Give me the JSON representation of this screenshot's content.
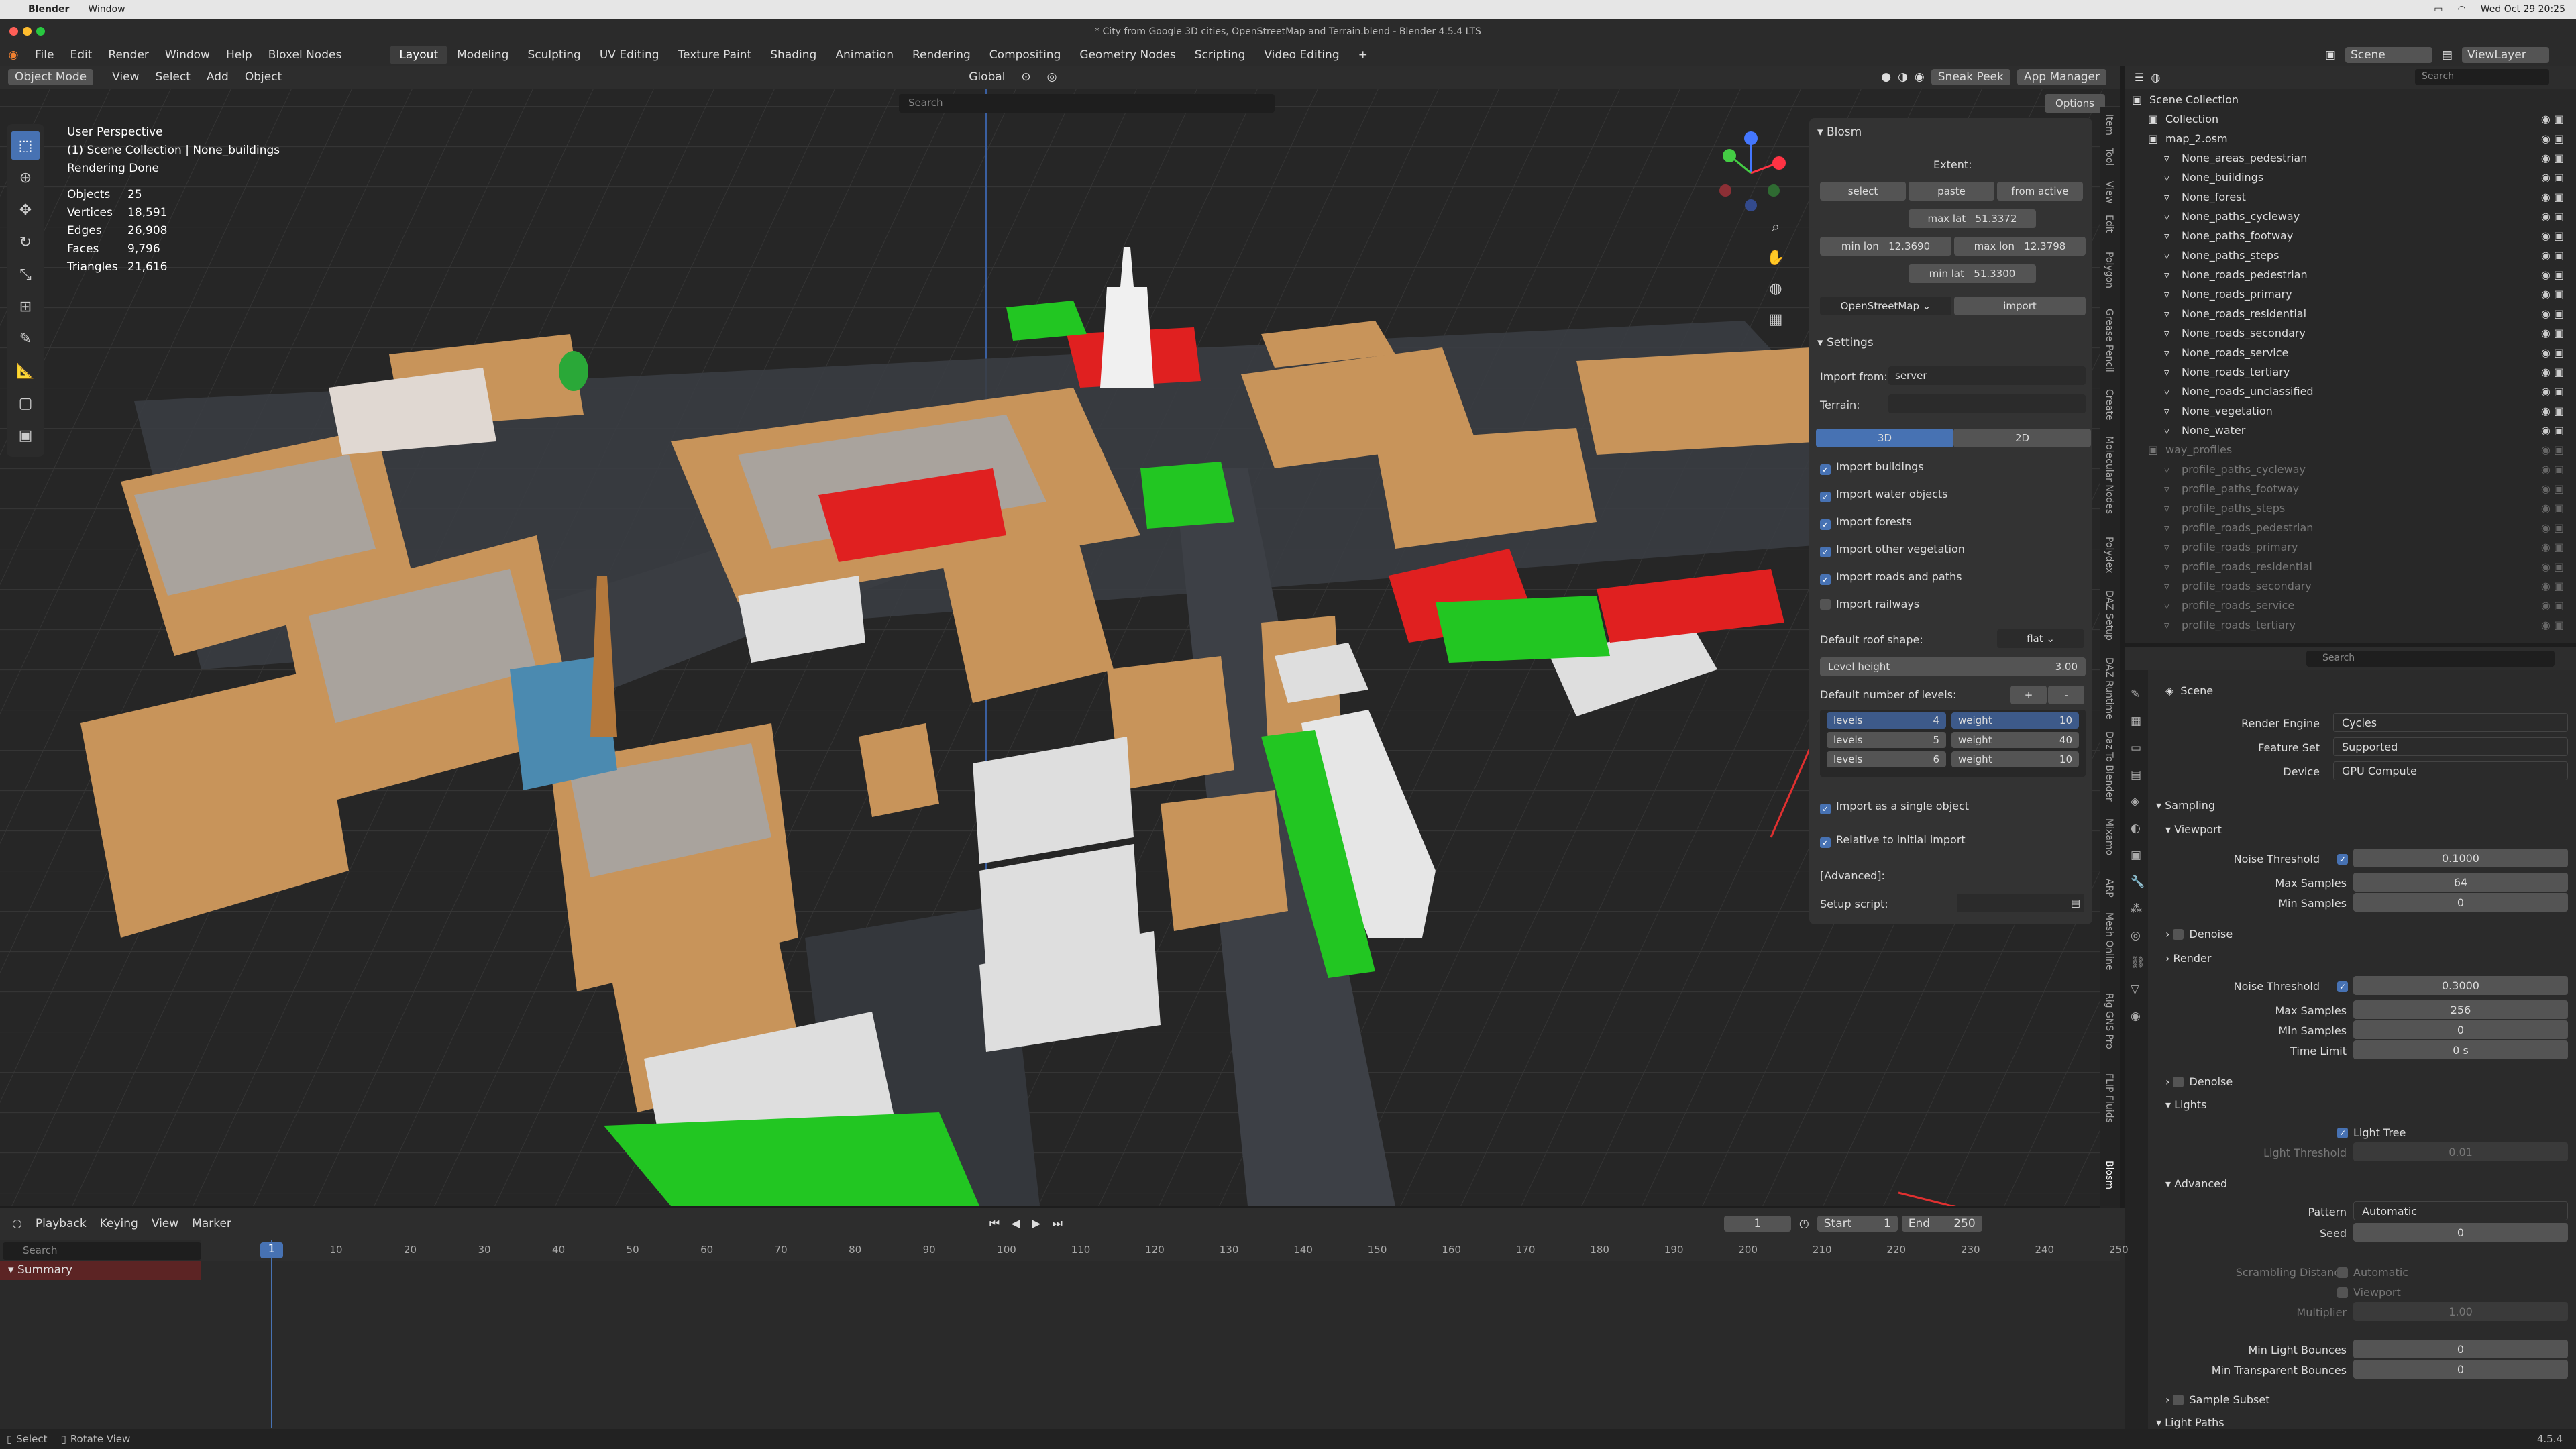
{
  "mac_menu": {
    "app": "Blender",
    "items": [
      "Window"
    ],
    "date": "Wed Oct 29  20:25"
  },
  "window_title": "* City from Google 3D cities, OpenStreetMap and Terrain.blend - Blender 4.5.4 LTS",
  "top_menu": [
    "File",
    "Edit",
    "Render",
    "Window",
    "Help",
    "Bloxel Nodes"
  ],
  "workspaces": [
    "Layout",
    "Modeling",
    "Sculpting",
    "UV Editing",
    "Texture Paint",
    "Shading",
    "Animation",
    "Rendering",
    "Compositing",
    "Geometry Nodes",
    "Scripting",
    "Video Editing"
  ],
  "scene_name": "Scene",
  "view_layer": "ViewLayer",
  "viewport_header": {
    "mode": "Object Mode",
    "menus": [
      "View",
      "Select",
      "Add",
      "Object"
    ],
    "transform": "Global",
    "sneak_peek": "Sneak Peek",
    "app_manager": "App Manager",
    "search_placeholder": "Search",
    "options": "Options"
  },
  "overlay_text": {
    "title": "User Perspective",
    "collection": "(1) Scene Collection | None_buildings",
    "status": "Rendering Done"
  },
  "stats": [
    {
      "label": "Objects",
      "value": "25"
    },
    {
      "label": "Vertices",
      "value": "18,591"
    },
    {
      "label": "Edges",
      "value": "26,908"
    },
    {
      "label": "Faces",
      "value": "9,796"
    },
    {
      "label": "Triangles",
      "value": "21,616"
    }
  ],
  "blosm": {
    "title": "Blosm",
    "extent_label": "Extent:",
    "select": "select",
    "paste": "paste",
    "from_active": "from active",
    "max_lat_label": "max lat",
    "max_lat": "51.3372",
    "min_lon_label": "min lon",
    "min_lon": "12.3690",
    "max_lon_label": "max lon",
    "max_lon": "12.3798",
    "min_lat_label": "min lat",
    "min_lat": "51.3300",
    "source": "OpenStreetMap",
    "import": "import",
    "settings": "Settings",
    "import_from_label": "Import from:",
    "import_from": "server",
    "terrain_label": "Terrain:",
    "mode_3d": "3D",
    "mode_2d": "2D",
    "checks": [
      {
        "label": "Import buildings",
        "checked": true
      },
      {
        "label": "Import water objects",
        "checked": true
      },
      {
        "label": "Import forests",
        "checked": true
      },
      {
        "label": "Import other vegetation",
        "checked": true
      },
      {
        "label": "Import roads and paths",
        "checked": true
      },
      {
        "label": "Import railways",
        "checked": false
      }
    ],
    "roof_label": "Default roof shape:",
    "roof": "flat",
    "level_height_label": "Level height",
    "level_height": "3.00",
    "levels_label": "Default number of levels:",
    "plus": "+",
    "minus": "-",
    "levels": [
      {
        "l": "levels",
        "lv": "4",
        "w": "weight",
        "wv": "10"
      },
      {
        "l": "levels",
        "lv": "5",
        "w": "weight",
        "wv": "40"
      },
      {
        "l": "levels",
        "lv": "6",
        "w": "weight",
        "wv": "10"
      }
    ],
    "single_object": "Import as a single object",
    "relative": "Relative to initial import",
    "advanced": "[Advanced]:",
    "setup_script": "Setup script:"
  },
  "side_tabs": [
    "Item",
    "Tool",
    "View",
    "Edit",
    "Polygon",
    "Grease Pencil",
    "Create",
    "Molecular Nodes",
    "Polydex",
    "DAZ Setup",
    "DAZ Runtime",
    "Daz To Blender",
    "Mixamo",
    "ARP",
    "Mesh Online",
    "Rig GNS Pro",
    "FLIP Fluids",
    "Blosm"
  ],
  "outliner": {
    "search": "Search",
    "scene_collection": "Scene Collection",
    "items": [
      {
        "name": "Collection",
        "level": 1,
        "dim": false
      },
      {
        "name": "map_2.osm",
        "level": 1,
        "dim": false
      },
      {
        "name": "None_areas_pedestrian",
        "level": 2,
        "dim": false
      },
      {
        "name": "None_buildings",
        "level": 2,
        "dim": false
      },
      {
        "name": "None_forest",
        "level": 2,
        "dim": false
      },
      {
        "name": "None_paths_cycleway",
        "level": 2,
        "dim": false
      },
      {
        "name": "None_paths_footway",
        "level": 2,
        "dim": false
      },
      {
        "name": "None_paths_steps",
        "level": 2,
        "dim": false
      },
      {
        "name": "None_roads_pedestrian",
        "level": 2,
        "dim": false
      },
      {
        "name": "None_roads_primary",
        "level": 2,
        "dim": false
      },
      {
        "name": "None_roads_residential",
        "level": 2,
        "dim": false
      },
      {
        "name": "None_roads_secondary",
        "level": 2,
        "dim": false
      },
      {
        "name": "None_roads_service",
        "level": 2,
        "dim": false
      },
      {
        "name": "None_roads_tertiary",
        "level": 2,
        "dim": false
      },
      {
        "name": "None_roads_unclassified",
        "level": 2,
        "dim": false
      },
      {
        "name": "None_vegetation",
        "level": 2,
        "dim": false
      },
      {
        "name": "None_water",
        "level": 2,
        "dim": false
      },
      {
        "name": "way_profiles",
        "level": 1,
        "dim": true
      },
      {
        "name": "profile_paths_cycleway",
        "level": 2,
        "dim": true
      },
      {
        "name": "profile_paths_footway",
        "level": 2,
        "dim": true
      },
      {
        "name": "profile_paths_steps",
        "level": 2,
        "dim": true
      },
      {
        "name": "profile_roads_pedestrian",
        "level": 2,
        "dim": true
      },
      {
        "name": "profile_roads_primary",
        "level": 2,
        "dim": true
      },
      {
        "name": "profile_roads_residential",
        "level": 2,
        "dim": true
      },
      {
        "name": "profile_roads_secondary",
        "level": 2,
        "dim": true
      },
      {
        "name": "profile_roads_service",
        "level": 2,
        "dim": true
      },
      {
        "name": "profile_roads_tertiary",
        "level": 2,
        "dim": true
      }
    ]
  },
  "props": {
    "search": "Search",
    "scene": "Scene",
    "render_engine_label": "Render Engine",
    "render_engine": "Cycles",
    "feature_set_label": "Feature Set",
    "feature_set": "Supported",
    "device_label": "Device",
    "device": "GPU Compute",
    "sampling": "Sampling",
    "viewport": "Viewport",
    "noise_threshold": "Noise Threshold",
    "v_noise": "0.1000",
    "max_samples": "Max Samples",
    "v_max": "64",
    "min_samples": "Min Samples",
    "v_min": "0",
    "denoise": "Denoise",
    "render": "Render",
    "r_noise": "0.3000",
    "r_max": "256",
    "r_min": "0",
    "time_limit": "Time Limit",
    "r_time": "0 s",
    "lights": "Lights",
    "light_tree": "Light Tree",
    "light_threshold": "Light Threshold",
    "light_threshold_v": "0.01",
    "advanced": "Advanced",
    "pattern_label": "Pattern",
    "pattern": "Automatic",
    "seed_label": "Seed",
    "seed": "0",
    "scrambling": "Scrambling Distance",
    "automatic": "Automatic",
    "viewport_cb": "Viewport",
    "multiplier": "Multiplier",
    "multiplier_v": "1.00",
    "min_light_bounces": "Min Light Bounces",
    "mlb": "0",
    "min_transparent": "Min Transparent Bounces",
    "mtb": "0",
    "sample_subset": "Sample Subset",
    "light_paths": "Light Paths"
  },
  "timeline": {
    "menus": [
      "Playback",
      "Keying",
      "View",
      "Marker"
    ],
    "current": "1",
    "start_label": "Start",
    "start": "1",
    "end_label": "End",
    "end": "250",
    "search": "Search",
    "summary": "Summary",
    "ticks": [
      "1",
      "10",
      "20",
      "30",
      "40",
      "50",
      "60",
      "70",
      "80",
      "90",
      "100",
      "110",
      "120",
      "130",
      "140",
      "150",
      "160",
      "170",
      "180",
      "190",
      "200",
      "210",
      "220",
      "230",
      "240",
      "250"
    ]
  },
  "statusbar": {
    "select": "Select",
    "rotate": "Rotate View",
    "version": "4.5.4"
  }
}
